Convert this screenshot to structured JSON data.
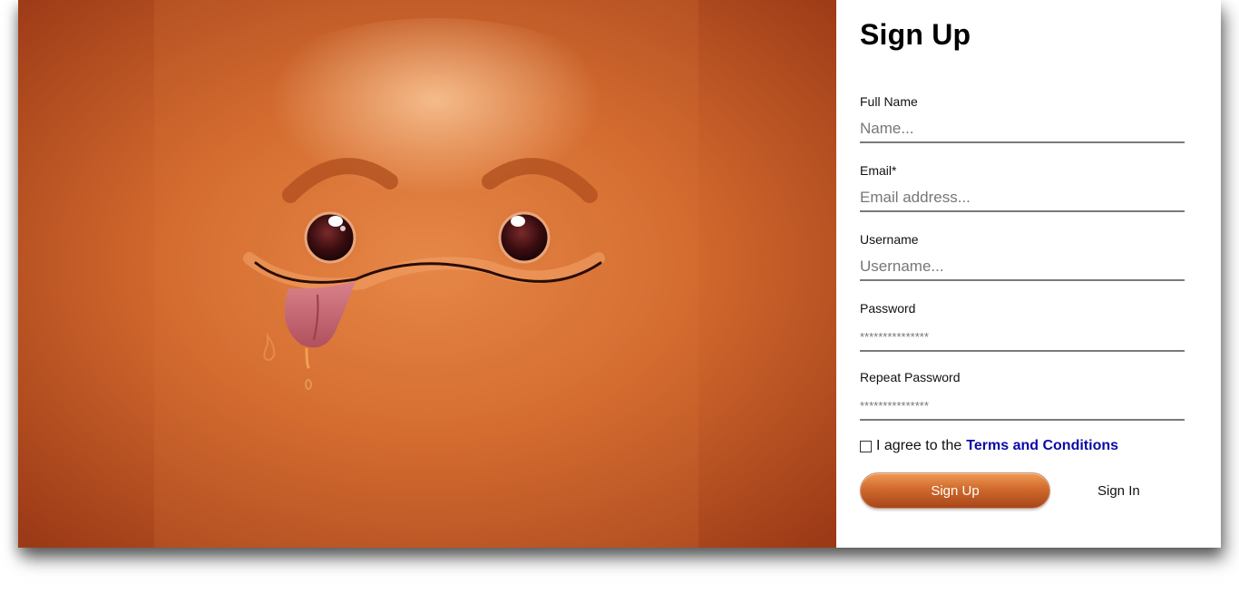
{
  "form": {
    "title": "Sign Up",
    "fields": [
      {
        "label": "Full Name",
        "placeholder": "Name...",
        "value": ""
      },
      {
        "label": "Email*",
        "placeholder": "Email address...",
        "value": ""
      },
      {
        "label": "Username",
        "placeholder": "Username...",
        "value": ""
      },
      {
        "label": "Password",
        "placeholder": "***************",
        "value": ""
      },
      {
        "label": "Repeat Password",
        "placeholder": "***************",
        "value": ""
      }
    ],
    "agree_text": "I agree to the",
    "terms_link": "Terms and Conditions",
    "signup_button": "Sign Up",
    "signin_link": "Sign In"
  },
  "colors": {
    "accent": "#d06a2c",
    "hero_background": "#c45e25",
    "link": "#0a0aa8"
  },
  "hero": {
    "icon": "smiley-face-tongue-illustration"
  }
}
